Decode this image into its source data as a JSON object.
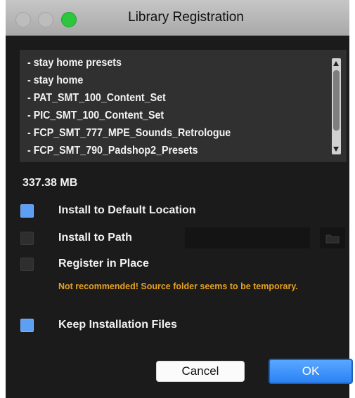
{
  "window": {
    "title": "Library Registration"
  },
  "library_list": {
    "items": [
      "- stay home presets",
      "- stay home",
      "- PAT_SMT_100_Content_Set",
      "- PIC_SMT_100_Content_Set",
      "- FCP_SMT_777_MPE_Sounds_Retrologue",
      "- FCP_SMT_790_Padshop2_Presets"
    ]
  },
  "size": "337.38 MB",
  "options": {
    "install_default": {
      "label": "Install to Default Location",
      "checked": true
    },
    "install_path": {
      "label": "Install to Path",
      "checked": false,
      "path_value": ""
    },
    "register_in_place": {
      "label": "Register in Place",
      "checked": false
    },
    "warning": "Not recommended! Source folder seems to be temporary.",
    "keep_files": {
      "label": "Keep Installation Files",
      "checked": true
    }
  },
  "buttons": {
    "cancel": "Cancel",
    "ok": "OK"
  },
  "colors": {
    "accent": "#5d9ff3",
    "warning": "#e6a11f",
    "window_bg": "#1b1b1b",
    "ok_button": "#2a82f5",
    "zoom_button": "#2dc63c"
  },
  "icons": {
    "close": "close-icon",
    "minimize": "minimize-icon",
    "zoom": "zoom-icon",
    "folder": "folder-icon",
    "scroll_up": "chevron-up-icon",
    "scroll_down": "chevron-down-icon"
  }
}
